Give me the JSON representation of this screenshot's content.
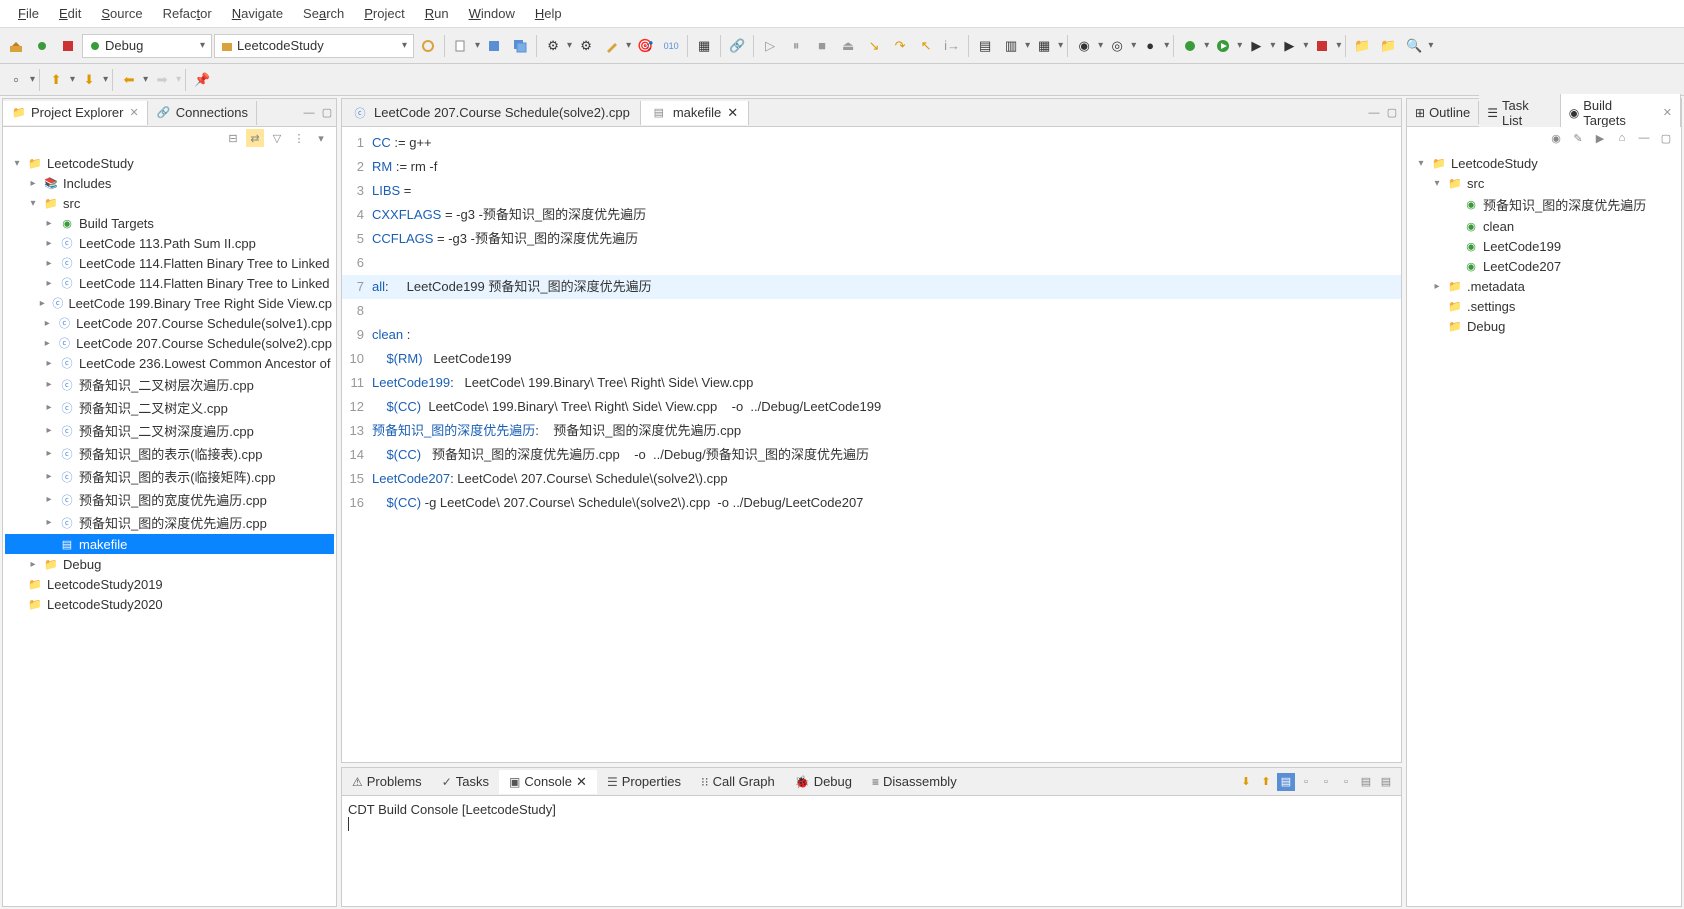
{
  "menu": {
    "file": "File",
    "edit": "Edit",
    "source": "Source",
    "refactor": "Refactor",
    "navigate": "Navigate",
    "search": "Search",
    "project": "Project",
    "run": "Run",
    "window": "Window",
    "help": "Help"
  },
  "toolbar": {
    "config": "Debug",
    "project": "LeetcodeStudy"
  },
  "left_panel": {
    "tab1": "Project Explorer",
    "tab2": "Connections",
    "tree": [
      {
        "d": 0,
        "exp": "▾",
        "icon": "proj",
        "label": "LeetcodeStudy"
      },
      {
        "d": 1,
        "exp": "▸",
        "icon": "inc",
        "label": "Includes"
      },
      {
        "d": 1,
        "exp": "▾",
        "icon": "fold",
        "label": "src"
      },
      {
        "d": 2,
        "exp": "▸",
        "icon": "tgt",
        "label": "Build Targets"
      },
      {
        "d": 2,
        "exp": "▸",
        "icon": "c",
        "label": "LeetCode 113.Path Sum II.cpp"
      },
      {
        "d": 2,
        "exp": "▸",
        "icon": "c",
        "label": "LeetCode 114.Flatten Binary Tree to Linked"
      },
      {
        "d": 2,
        "exp": "▸",
        "icon": "c",
        "label": "LeetCode 114.Flatten Binary Tree to Linked"
      },
      {
        "d": 2,
        "exp": "▸",
        "icon": "c",
        "label": "LeetCode 199.Binary Tree Right Side View.cp"
      },
      {
        "d": 2,
        "exp": "▸",
        "icon": "c",
        "label": "LeetCode 207.Course Schedule(solve1).cpp"
      },
      {
        "d": 2,
        "exp": "▸",
        "icon": "c",
        "label": "LeetCode 207.Course Schedule(solve2).cpp"
      },
      {
        "d": 2,
        "exp": "▸",
        "icon": "c",
        "label": "LeetCode 236.Lowest Common Ancestor of"
      },
      {
        "d": 2,
        "exp": "▸",
        "icon": "c",
        "label": "预备知识_二叉树层次遍历.cpp"
      },
      {
        "d": 2,
        "exp": "▸",
        "icon": "c",
        "label": "预备知识_二叉树定义.cpp"
      },
      {
        "d": 2,
        "exp": "▸",
        "icon": "c",
        "label": "预备知识_二叉树深度遍历.cpp"
      },
      {
        "d": 2,
        "exp": "▸",
        "icon": "c",
        "label": "预备知识_图的表示(临接表).cpp"
      },
      {
        "d": 2,
        "exp": "▸",
        "icon": "c",
        "label": "预备知识_图的表示(临接矩阵).cpp"
      },
      {
        "d": 2,
        "exp": "▸",
        "icon": "c",
        "label": "预备知识_图的宽度优先遍历.cpp"
      },
      {
        "d": 2,
        "exp": "▸",
        "icon": "c",
        "label": "预备知识_图的深度优先遍历.cpp"
      },
      {
        "d": 2,
        "exp": "",
        "icon": "mk",
        "label": "makefile",
        "sel": true
      },
      {
        "d": 1,
        "exp": "▸",
        "icon": "fold",
        "label": "Debug"
      },
      {
        "d": 0,
        "exp": "",
        "icon": "proj",
        "label": "LeetcodeStudy2019"
      },
      {
        "d": 0,
        "exp": "",
        "icon": "proj",
        "label": "LeetcodeStudy2020"
      }
    ]
  },
  "editor": {
    "tab1": "LeetCode 207.Course Schedule(solve2).cpp",
    "tab2": "makefile",
    "lines": [
      {
        "n": 1,
        "seg": [
          {
            "t": "CC",
            "c": "kw"
          },
          {
            "t": " := g++"
          }
        ]
      },
      {
        "n": 2,
        "seg": [
          {
            "t": "RM",
            "c": "kw"
          },
          {
            "t": " := rm -f"
          }
        ]
      },
      {
        "n": 3,
        "seg": [
          {
            "t": "LIBS",
            "c": "kw"
          },
          {
            "t": " ="
          }
        ]
      },
      {
        "n": 4,
        "seg": [
          {
            "t": "CXXFLAGS",
            "c": "kw"
          },
          {
            "t": " = -g3 -预备知识_图的深度优先遍历"
          }
        ]
      },
      {
        "n": 5,
        "seg": [
          {
            "t": "CCFLAGS",
            "c": "kw"
          },
          {
            "t": " = -g3 -预备知识_图的深度优先遍历"
          }
        ]
      },
      {
        "n": 6,
        "seg": [
          {
            "t": ""
          }
        ]
      },
      {
        "n": 7,
        "hl": true,
        "seg": [
          {
            "t": "all",
            "c": "kw"
          },
          {
            "t": ":     LeetCode199 预备知识_图的深度优先遍历"
          }
        ]
      },
      {
        "n": 8,
        "seg": [
          {
            "t": ""
          }
        ]
      },
      {
        "n": 9,
        "seg": [
          {
            "t": "clean ",
            "c": "kw"
          },
          {
            "t": ":"
          }
        ]
      },
      {
        "n": 10,
        "seg": [
          {
            "t": "    "
          },
          {
            "t": "$(RM)",
            "c": "var"
          },
          {
            "t": "   LeetCode199"
          }
        ]
      },
      {
        "n": 11,
        "seg": [
          {
            "t": "LeetCode199",
            "c": "kw"
          },
          {
            "t": ":   LeetCode\\ 199.Binary\\ Tree\\ Right\\ Side\\ View.cpp"
          }
        ]
      },
      {
        "n": 12,
        "seg": [
          {
            "t": "    "
          },
          {
            "t": "$(CC)",
            "c": "var"
          },
          {
            "t": "  LeetCode\\ 199.Binary\\ Tree\\ Right\\ Side\\ View.cpp    -o  ../Debug/LeetCode199"
          }
        ]
      },
      {
        "n": 13,
        "seg": [
          {
            "t": "预备知识_图的深度优先遍历",
            "c": "kw"
          },
          {
            "t": ":    预备知识_图的深度优先遍历.cpp"
          }
        ]
      },
      {
        "n": 14,
        "seg": [
          {
            "t": "    "
          },
          {
            "t": "$(CC)",
            "c": "var"
          },
          {
            "t": "   预备知识_图的深度优先遍历.cpp    -o  ../Debug/预备知识_图的深度优先遍历"
          }
        ]
      },
      {
        "n": 15,
        "seg": [
          {
            "t": "LeetCode207",
            "c": "kw"
          },
          {
            "t": ": LeetCode\\ 207.Course\\ Schedule\\(solve2\\).cpp"
          }
        ]
      },
      {
        "n": 16,
        "seg": [
          {
            "t": "    "
          },
          {
            "t": "$(CC)",
            "c": "var"
          },
          {
            "t": " -g LeetCode\\ 207.Course\\ Schedule\\(solve2\\).cpp  -o ../Debug/LeetCode207"
          }
        ]
      }
    ]
  },
  "right_panel": {
    "tab1": "Outline",
    "tab2": "Task List",
    "tab3": "Build Targets",
    "tree": [
      {
        "d": 0,
        "exp": "▾",
        "icon": "proj",
        "label": "LeetcodeStudy"
      },
      {
        "d": 1,
        "exp": "▾",
        "icon": "fold",
        "label": "src"
      },
      {
        "d": 2,
        "exp": "",
        "icon": "tgt",
        "label": "预备知识_图的深度优先遍历"
      },
      {
        "d": 2,
        "exp": "",
        "icon": "tgt",
        "label": "clean"
      },
      {
        "d": 2,
        "exp": "",
        "icon": "tgt",
        "label": "LeetCode199"
      },
      {
        "d": 2,
        "exp": "",
        "icon": "tgt",
        "label": "LeetCode207"
      },
      {
        "d": 1,
        "exp": "▸",
        "icon": "fold",
        "label": ".metadata"
      },
      {
        "d": 1,
        "exp": "",
        "icon": "fold",
        "label": ".settings"
      },
      {
        "d": 1,
        "exp": "",
        "icon": "fold",
        "label": "Debug"
      }
    ]
  },
  "console": {
    "tabs": {
      "problems": "Problems",
      "tasks": "Tasks",
      "console": "Console",
      "properties": "Properties",
      "callgraph": "Call Graph",
      "debug": "Debug",
      "disasm": "Disassembly"
    },
    "title": "CDT Build Console [LeetcodeStudy]"
  }
}
